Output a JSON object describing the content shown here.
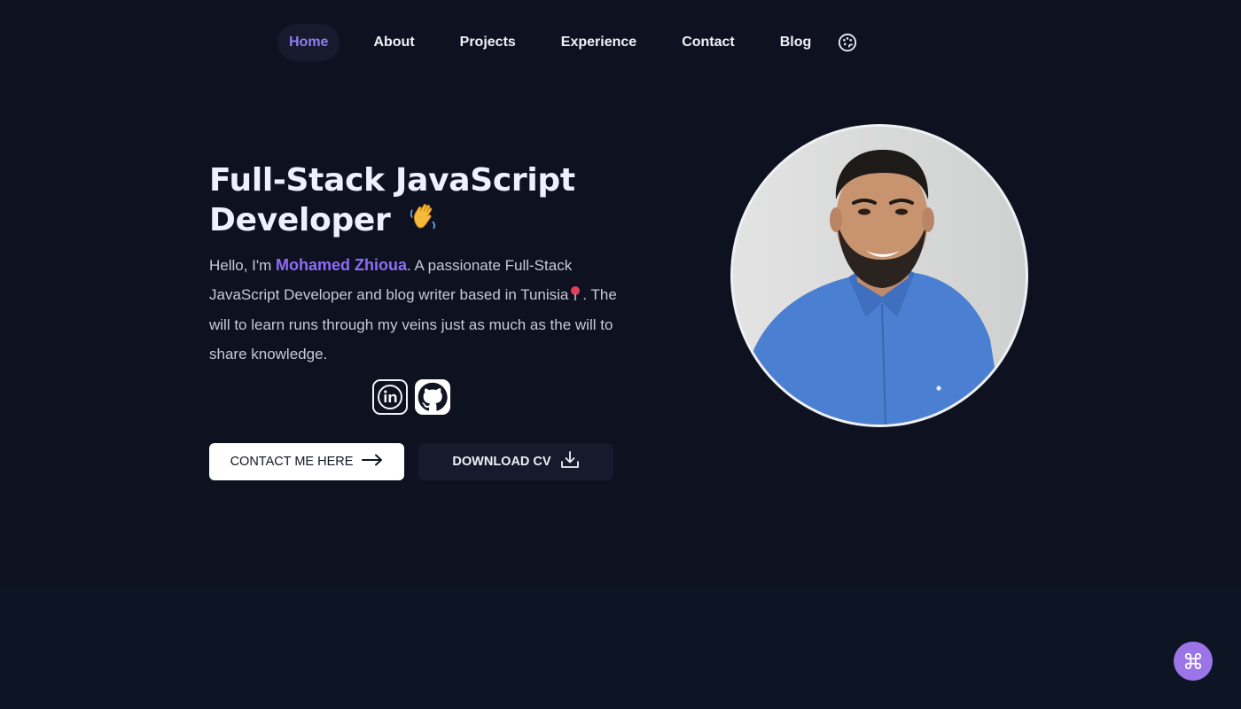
{
  "nav": {
    "items": [
      {
        "label": "Home",
        "active": true
      },
      {
        "label": "About"
      },
      {
        "label": "Projects"
      },
      {
        "label": "Experience"
      },
      {
        "label": "Contact"
      },
      {
        "label": "Blog"
      }
    ],
    "theme_icon": "palette-icon"
  },
  "hero": {
    "title_line1": "Full-Stack JavaScript",
    "title_line2": "Developer",
    "title_emoji": "wave-hand-icon",
    "intro_prefix": "Hello, I'm ",
    "name": "Mohamed Zhioua",
    "intro_body": ". A passionate Full-Stack JavaScript Developer and blog writer based in Tunisia",
    "intro_after_pin": ". The will to learn runs through my veins just as much as the will to share knowledge.",
    "pin_icon": "location-pin-icon"
  },
  "socials": [
    {
      "icon": "linkedin-icon"
    },
    {
      "icon": "github-icon"
    }
  ],
  "buttons": {
    "contact_label": "CONTACT ME HERE",
    "cv_label": "DOWNLOAD CV"
  },
  "colors": {
    "background": "#0e1120",
    "accent": "#8f6cf6",
    "lower_section": "#0d1424",
    "cmd_button": "#9b74e8"
  }
}
